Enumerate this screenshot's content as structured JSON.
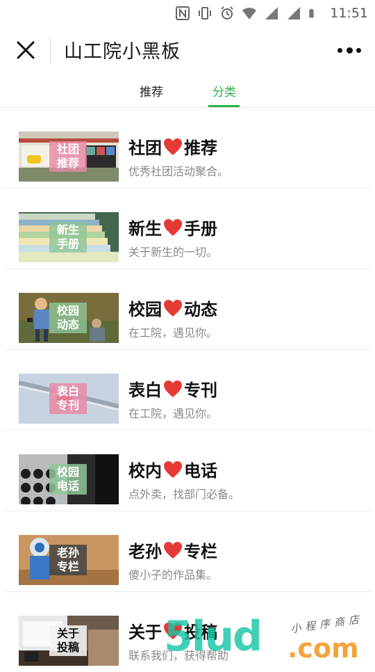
{
  "status_bar": {
    "time": "11:51",
    "icons": [
      "nfc-icon",
      "vibrate-icon",
      "alarm-icon",
      "wifi-icon",
      "signal-icon",
      "signal-icon-2",
      "battery-icon"
    ]
  },
  "header": {
    "title": "山工院小黑板",
    "close_icon": "close-icon",
    "more_icon": "more-icon"
  },
  "tabs": [
    {
      "label": "推荐",
      "active": false
    },
    {
      "label": "分类",
      "active": true
    }
  ],
  "colors": {
    "accent": "#2bb14a",
    "heart": "#e53935"
  },
  "items": [
    {
      "title_left": "社团",
      "title_right": "推荐",
      "subtitle": "优秀社团活动聚合。",
      "badge": [
        "社团",
        "推荐"
      ],
      "badge_color": "#e88aa6"
    },
    {
      "title_left": "新生",
      "title_right": "手册",
      "subtitle": "关于新生的一切。",
      "badge": [
        "新生",
        "手册"
      ],
      "badge_color": "#8fc59a"
    },
    {
      "title_left": "校园",
      "title_right": "动态",
      "subtitle": "在工院，遇见你。",
      "badge": [
        "校园",
        "动态"
      ],
      "badge_color": "#8fc59a"
    },
    {
      "title_left": "表白",
      "title_right": "专刊",
      "subtitle": "在工院，遇见你。",
      "badge": [
        "表白",
        "专刊"
      ],
      "badge_color": "#e88aa6"
    },
    {
      "title_left": "校内",
      "title_right": "电话",
      "subtitle": "点外卖，找部门必备。",
      "badge": [
        "校园",
        "电话"
      ],
      "badge_color": "#8fc59a"
    },
    {
      "title_left": "老孙",
      "title_right": "专栏",
      "subtitle": "傻小子的作品集。",
      "badge": [
        "老孙",
        "专栏"
      ],
      "badge_color": "#444444"
    },
    {
      "title_left": "关于",
      "title_right": "投稿",
      "subtitle": "联系我们，获得帮助",
      "badge": [
        "关于",
        "投稿"
      ],
      "badge_color": "#f2f2f2"
    }
  ],
  "watermark": {
    "big": "5lud",
    "com": ".com",
    "small": "小程序商店"
  }
}
